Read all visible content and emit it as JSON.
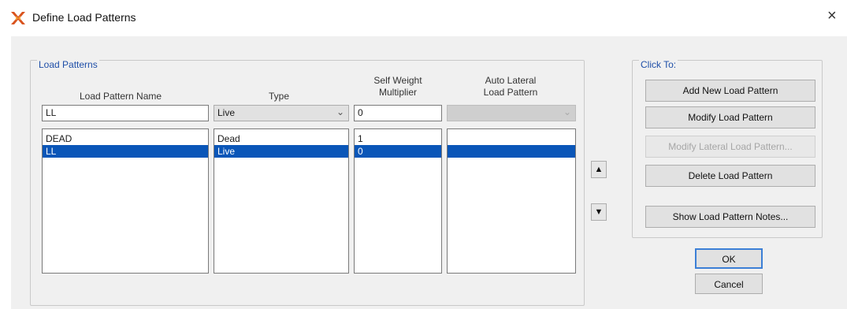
{
  "window": {
    "title": "Define Load Patterns",
    "close_glyph": "×",
    "icon": "app-icon"
  },
  "load_patterns": {
    "group_title": "Load Patterns",
    "headers": {
      "name": "Load Pattern Name",
      "type": "Type",
      "self_weight": [
        "Self Weight",
        "Multiplier"
      ],
      "auto_lateral": [
        "Auto Lateral",
        "Load Pattern"
      ]
    },
    "edit": {
      "name": "LL",
      "type": "Live",
      "self_weight": "0",
      "auto_lateral": ""
    },
    "rows": [
      {
        "name": "DEAD",
        "type": "Dead",
        "self_weight": "1",
        "auto_lateral": "",
        "selected": false
      },
      {
        "name": "LL",
        "type": "Live",
        "self_weight": "0",
        "auto_lateral": "",
        "selected": true
      }
    ],
    "move_up_glyph": "▲",
    "move_down_glyph": "▼"
  },
  "click_to": {
    "group_title": "Click To:",
    "buttons": {
      "add": "Add New Load Pattern",
      "modify": "Modify Load Pattern",
      "modify_lateral": "Modify Lateral Load Pattern...",
      "delete": "Delete Load Pattern",
      "notes": "Show Load Pattern Notes..."
    }
  },
  "footer": {
    "ok": "OK",
    "cancel": "Cancel"
  },
  "colors": {
    "selection": "#0a56b8",
    "group_title": "#1f4fa8",
    "dialog_bg": "#f0f0f0"
  }
}
